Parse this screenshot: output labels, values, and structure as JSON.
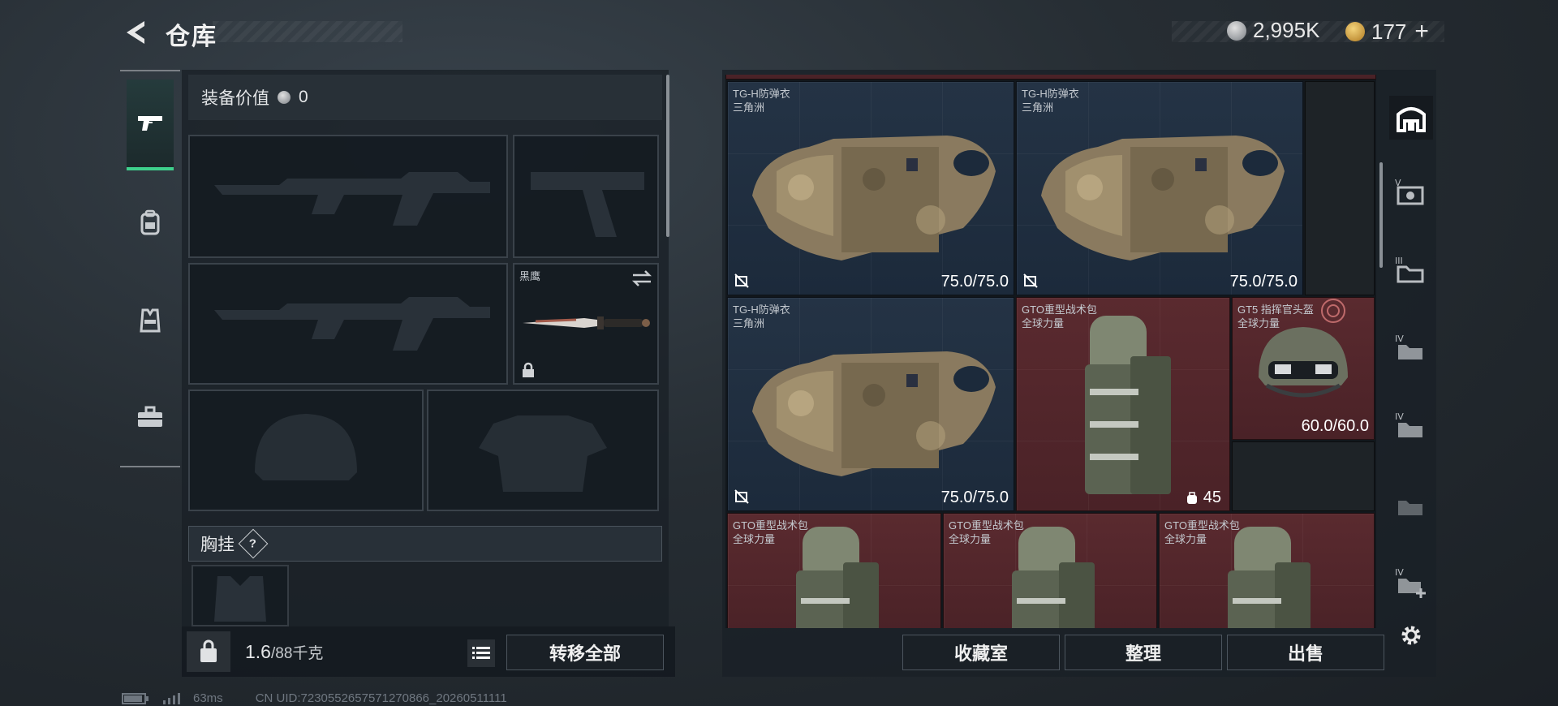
{
  "header": {
    "title": "仓库",
    "coins": "2,995K",
    "tokens": "177",
    "add_symbol": "+"
  },
  "left_nav": {
    "items": [
      "pistol-icon",
      "backpack-icon",
      "vest-icon",
      "toolbox-icon"
    ],
    "active": "pistol-icon"
  },
  "equipment": {
    "value_label": "装备价值",
    "value": "0",
    "knife_name": "黑鹰",
    "chest_label": "胸挂",
    "help_symbol": "?"
  },
  "bottom_left": {
    "weight": "1.6",
    "weight_max": "/88千克",
    "transfer_all": "转移全部"
  },
  "inventory": {
    "items": [
      {
        "name": "TG-H防弹衣",
        "faction": "三角洲",
        "durability": "75.0/75.0",
        "color": "blue"
      },
      {
        "name": "TG-H防弹衣",
        "faction": "三角洲",
        "durability": "75.0/75.0",
        "color": "blue"
      },
      {
        "name": "TG-H防弹衣",
        "faction": "三角洲",
        "durability": "75.0/75.0",
        "color": "blue"
      },
      {
        "name": "GTO重型战术包",
        "faction": "全球力量",
        "capacity": "45",
        "color": "red"
      },
      {
        "name": "GT5 指挥官头盔",
        "faction": "全球力量",
        "durability": "60.0/60.0",
        "color": "red"
      },
      {
        "name": "GTO重型战术包",
        "faction": "全球力量",
        "color": "red"
      },
      {
        "name": "GTO重型战术包",
        "faction": "全球力量",
        "color": "red"
      },
      {
        "name": "GTO重型战术包",
        "faction": "全球力量",
        "color": "red"
      }
    ]
  },
  "actions": {
    "collection": "收藏室",
    "organize": "整理",
    "sell": "出售"
  },
  "right_nav": {
    "roman": [
      "V",
      "III",
      "IV",
      "IV",
      "",
      "IV"
    ]
  },
  "status": {
    "ping": "63ms",
    "uid": "CN UID:7230552657571270866_20260511111"
  },
  "colors": {
    "accent_green": "#3ed08c",
    "rarity_blue": "#243345",
    "rarity_red": "#5a2a2f"
  }
}
